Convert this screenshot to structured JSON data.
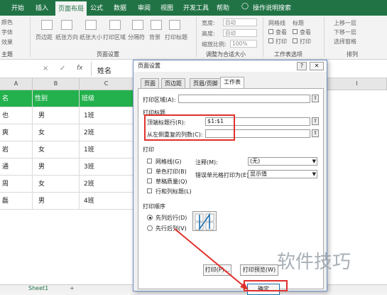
{
  "ribbon": {
    "tabs": [
      "开始",
      "插入",
      "页面布局",
      "公式",
      "数据",
      "审阅",
      "视图",
      "开发工具",
      "帮助"
    ],
    "active_tab": "页面布局",
    "tell_me": "操作说明搜索",
    "left_items": [
      "颜色",
      "字体",
      "效果"
    ],
    "page_setup_buttons": [
      "页边距",
      "纸张方向",
      "纸张大小",
      "打印区域",
      "分隔符",
      "背景",
      "打印标题"
    ],
    "width_label": "宽度:",
    "height_label": "高度:",
    "scale_label": "缩放比例:",
    "width_value": "自动",
    "height_value": "自动",
    "scale_value": "100%",
    "gridlines_label": "网格线",
    "headings_label": "标题",
    "view_label_1": "查看",
    "view_label_2": "查看",
    "print_label_1": "打印",
    "print_label_2": "打印",
    "arrange_items": [
      "上移一层",
      "下移一层",
      "选择窗格"
    ],
    "group_theme": "主题",
    "group_page_setup": "页面设置",
    "group_scale": "调整为合适大小",
    "group_sheet_options": "工作表选项",
    "group_arrange": "排列"
  },
  "formula_bar": {
    "cancel": "×",
    "confirm": "✓",
    "fx": "fx",
    "value": "姓名"
  },
  "grid": {
    "columns": [
      "A",
      "B",
      "C",
      "I"
    ],
    "header_row": [
      "名",
      "性别",
      "班级"
    ],
    "rows": [
      [
        "也",
        "男",
        "1班"
      ],
      [
        "爽",
        "女",
        "2班"
      ],
      [
        "岩",
        "女",
        "1班"
      ],
      [
        "通",
        "男",
        "3班"
      ],
      [
        "周",
        "女",
        "2班"
      ],
      [
        "磊",
        "男",
        "4班"
      ]
    ]
  },
  "sheet_tabs": {
    "active": "Sheet1",
    "add": "+"
  },
  "dialog": {
    "title": "页面设置",
    "help": "?",
    "close": "✕",
    "tabs": [
      "页面",
      "页边距",
      "页眉/页脚",
      "工作表"
    ],
    "active_tab": "工作表",
    "print_area_label": "打印区域(A):",
    "print_titles_label": "打印标题",
    "rows_repeat_label": "顶端标题行(R):",
    "rows_repeat_value": "$1:$1",
    "cols_repeat_label": "从左侧重复的列数(C):",
    "cols_repeat_value": "",
    "print_section": "打印",
    "gridlines": "网格线(G)",
    "mono": "单色打印(B)",
    "draft": "草稿质量(Q)",
    "row_col_headings": "行和列标题(L)",
    "comments_label": "注释(M):",
    "comments_value": "(无)",
    "errors_label": "错误单元格打印为(E):",
    "errors_value": "显示值",
    "order_section": "打印顺序",
    "down_then_over": "先列后行(D)",
    "over_then_down": "先行后列(V)",
    "print_button": "打印(P)...",
    "preview_button": "打印预览(W)",
    "ok_button": "确定"
  },
  "watermark": "软件技巧",
  "colors": {
    "excel_green": "#217346",
    "header_fill": "#22b14c",
    "highlight_red": "#e0302b"
  }
}
